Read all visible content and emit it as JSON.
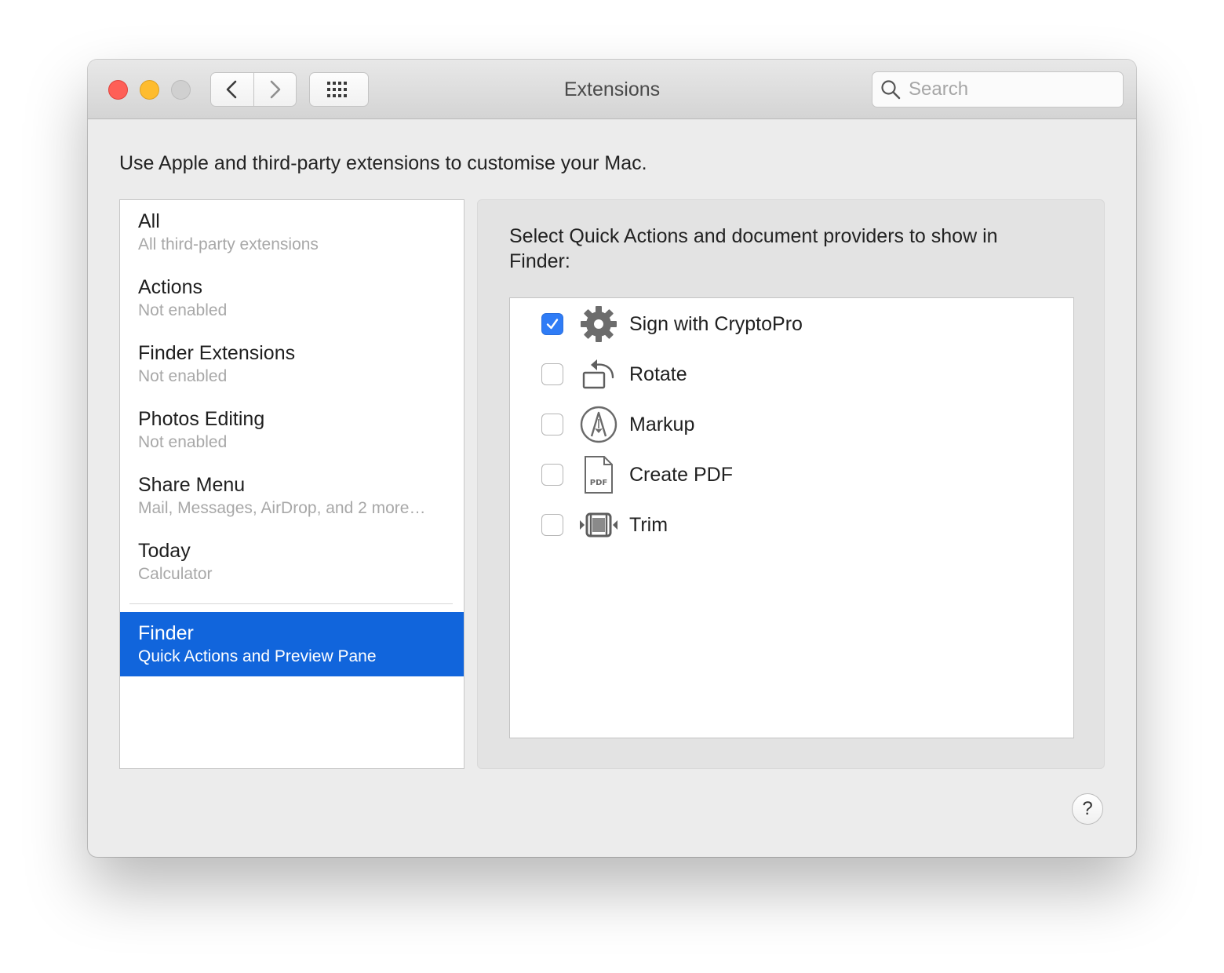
{
  "window": {
    "title": "Extensions"
  },
  "toolbar": {
    "back_icon": "chevron-left-icon",
    "forward_icon": "chevron-right-icon",
    "grid_icon": "grid-icon"
  },
  "search": {
    "placeholder": "Search",
    "value": ""
  },
  "description": "Use Apple and third-party extensions to customise your Mac.",
  "sidebar": {
    "items": [
      {
        "label": "All",
        "sub": "All third-party extensions"
      },
      {
        "label": "Actions",
        "sub": "Not enabled"
      },
      {
        "label": "Finder Extensions",
        "sub": "Not enabled"
      },
      {
        "label": "Photos Editing",
        "sub": "Not enabled"
      },
      {
        "label": "Share Menu",
        "sub": "Mail, Messages, AirDrop, and 2 more…"
      },
      {
        "label": "Today",
        "sub": "Calculator"
      }
    ],
    "selected": {
      "label": "Finder",
      "sub": "Quick Actions and Preview Pane"
    }
  },
  "panel": {
    "heading": "Select Quick Actions and document providers to show in Finder:",
    "actions": [
      {
        "label": "Sign with CryptoPro",
        "checked": true,
        "icon": "gear-icon"
      },
      {
        "label": "Rotate",
        "checked": false,
        "icon": "rotate-icon"
      },
      {
        "label": "Markup",
        "checked": false,
        "icon": "markup-icon"
      },
      {
        "label": "Create PDF",
        "checked": false,
        "icon": "pdf-icon",
        "icon_text": "PDF"
      },
      {
        "label": "Trim",
        "checked": false,
        "icon": "trim-icon"
      }
    ]
  },
  "help": {
    "label": "?"
  },
  "colors": {
    "accent": "#1165dc",
    "checkbox_on": "#2f7cf6",
    "close": "#fe5f57",
    "minimize": "#febc2e"
  }
}
